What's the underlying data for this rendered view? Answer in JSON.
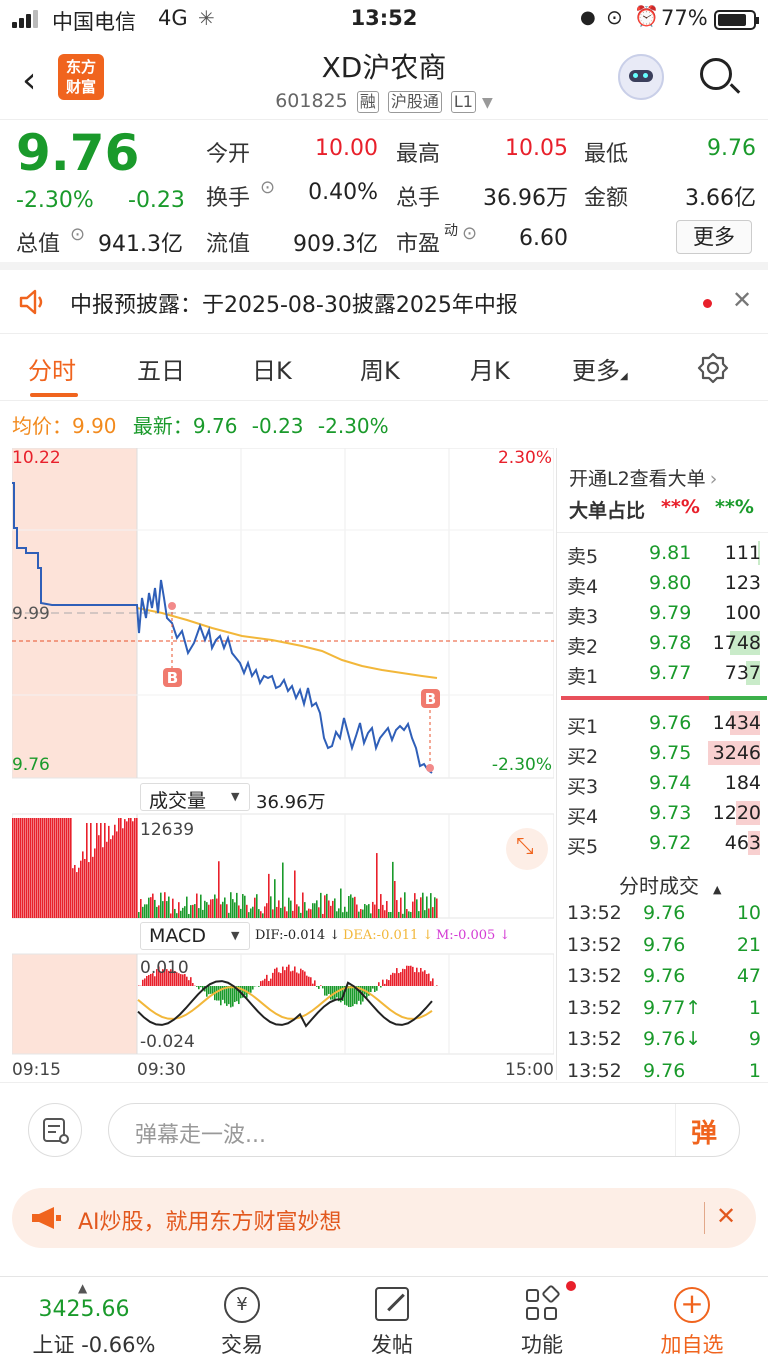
{
  "status": {
    "carrier": "中国电信",
    "network": "4G",
    "time": "13:52",
    "battery": "77%"
  },
  "header": {
    "title": "XD沪农商",
    "code": "601825",
    "tags": [
      "融",
      "沪股通",
      "L1"
    ],
    "logo_text_1": "东方",
    "logo_text_2": "财富"
  },
  "quote": {
    "price": "9.76",
    "change_pct": "-2.30%",
    "change": "-0.23",
    "open_label": "今开",
    "open": "10.00",
    "high_label": "最高",
    "high": "10.05",
    "low_label": "最低",
    "low": "9.76",
    "turnover_label": "换手",
    "turnover": "0.40%",
    "vol_label": "总手",
    "vol": "36.96万",
    "amount_label": "金额",
    "amount": "3.66亿",
    "mcap_label": "总值",
    "mcap": "941.3亿",
    "float_label": "流值",
    "float": "909.3亿",
    "pe_label": "市盈",
    "pe_sup": "动",
    "pe": "6.60",
    "more": "更多"
  },
  "notice": {
    "text": "中报预披露：于2025-08-30披露2025年中报"
  },
  "tabs": [
    "分时",
    "五日",
    "日K",
    "周K",
    "月K",
    "更多"
  ],
  "avg": {
    "avg_label": "均价：",
    "avg": "9.90",
    "last_label": "最新：",
    "last": "9.76",
    "chg": "-0.23",
    "pct": "-2.30%"
  },
  "chart_labels": {
    "y_top": "10.22",
    "y_mid": "9.99",
    "y_bot": "9.76",
    "pct_top": "2.30%",
    "pct_bot": "-2.30%",
    "marker": "B",
    "vol_sel": "成交量",
    "vol_total": "36.96万",
    "vol_max": "12639",
    "macd_sel": "MACD",
    "dif": "DIF:-0.014 ↓",
    "dea": "DEA:-0.011 ↓",
    "m": "M:-0.005 ↓",
    "macd_top": "0.010",
    "macd_bot": "-0.024",
    "t_start": "09:15",
    "t_open": "09:30",
    "t_end": "15:00"
  },
  "book": {
    "header": "开通L2查看大单",
    "big_ratio_label": "大单占比",
    "big_red": "**%",
    "big_green": "**%",
    "asks": [
      {
        "name": "卖5",
        "price": "9.81",
        "vol": "111"
      },
      {
        "name": "卖4",
        "price": "9.80",
        "vol": "123"
      },
      {
        "name": "卖3",
        "price": "9.79",
        "vol": "100"
      },
      {
        "name": "卖2",
        "price": "9.78",
        "vol": "1748"
      },
      {
        "name": "卖1",
        "price": "9.77",
        "vol": "737"
      }
    ],
    "bids": [
      {
        "name": "买1",
        "price": "9.76",
        "vol": "1434"
      },
      {
        "name": "买2",
        "price": "9.75",
        "vol": "3246"
      },
      {
        "name": "买3",
        "price": "9.74",
        "vol": "184"
      },
      {
        "name": "买4",
        "price": "9.73",
        "vol": "1220"
      },
      {
        "name": "买5",
        "price": "9.72",
        "vol": "463"
      }
    ],
    "ticks_title": "分时成交",
    "ticks": [
      {
        "time": "13:52",
        "price": "9.76",
        "vol": "10"
      },
      {
        "time": "13:52",
        "price": "9.76",
        "vol": "21"
      },
      {
        "time": "13:52",
        "price": "9.76",
        "vol": "47"
      },
      {
        "time": "13:52",
        "price": "9.77↑",
        "vol": "1"
      },
      {
        "time": "13:52",
        "price": "9.76↓",
        "vol": "9"
      },
      {
        "time": "13:52",
        "price": "9.76",
        "vol": "1"
      }
    ]
  },
  "comment": {
    "placeholder": "弹幕走一波...",
    "danmu": "弹"
  },
  "ai_banner": {
    "text": "AI炒股，就用东方财富妙想"
  },
  "nav": {
    "index_value": "3425.66",
    "index_label": "上证 -0.66%",
    "trade": "交易",
    "post": "发帖",
    "func": "功能",
    "add": "加自选"
  },
  "colors": {
    "up": "#e8202b",
    "down": "#1a9a2b",
    "accent": "#f0641e",
    "avg_line": "#f2b73a",
    "price_line": "#2f5fb8"
  }
}
